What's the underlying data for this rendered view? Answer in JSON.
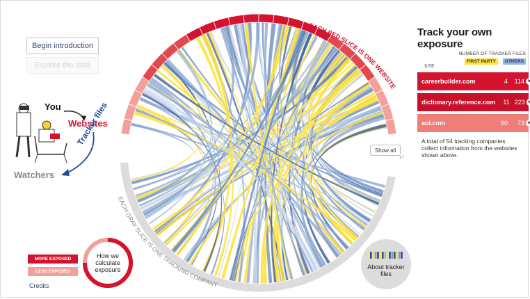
{
  "controls": {
    "begin_intro": "Begin introduction",
    "explore": "Explore the data"
  },
  "diagram_labels": {
    "red_arc": "EACH RED SLICE IS ONE WEBSITE",
    "gray_arc": "EACH GRAY SLICE IS ONE TRACKING COMPANY",
    "show_all": "Show all"
  },
  "explainer": {
    "you": "You",
    "websites": "Websites",
    "tracker_files": "Tracker files",
    "watchers": "Watchers"
  },
  "legend": {
    "more": "MORE EXPOSED",
    "less": "LESS EXPOSED",
    "how_calc": "How we calculate exposure",
    "credits": "Credits"
  },
  "about": "About tracker files",
  "panel": {
    "title": "Track your own exposure",
    "num_header": "NUMBER OF TRACKER FILES",
    "site_header": "SITE",
    "first_party": "FIRST PARTY",
    "others": "OTHERS",
    "sites": [
      {
        "name": "careerbuilder.com",
        "first_party": "4",
        "others": "114",
        "color": "#d4142f"
      },
      {
        "name": "dictionary.reference.com",
        "first_party": "11",
        "others": "223",
        "color": "#c71029"
      },
      {
        "name": "aol.com",
        "first_party": "60",
        "others": "73",
        "color": "#ef7e78"
      }
    ],
    "note": "A total of 54 tracking companies collect information from the websites shown above."
  },
  "colors": {
    "red": "#d4142f",
    "pink": "#f2a09b",
    "gray_arc": "#dcdcdc",
    "ribbon_blue": "#7d9ccc",
    "ribbon_dark": "#2f4f8a",
    "ribbon_yellow": "#ffe02e",
    "navy_text": "#1f4a9c"
  }
}
